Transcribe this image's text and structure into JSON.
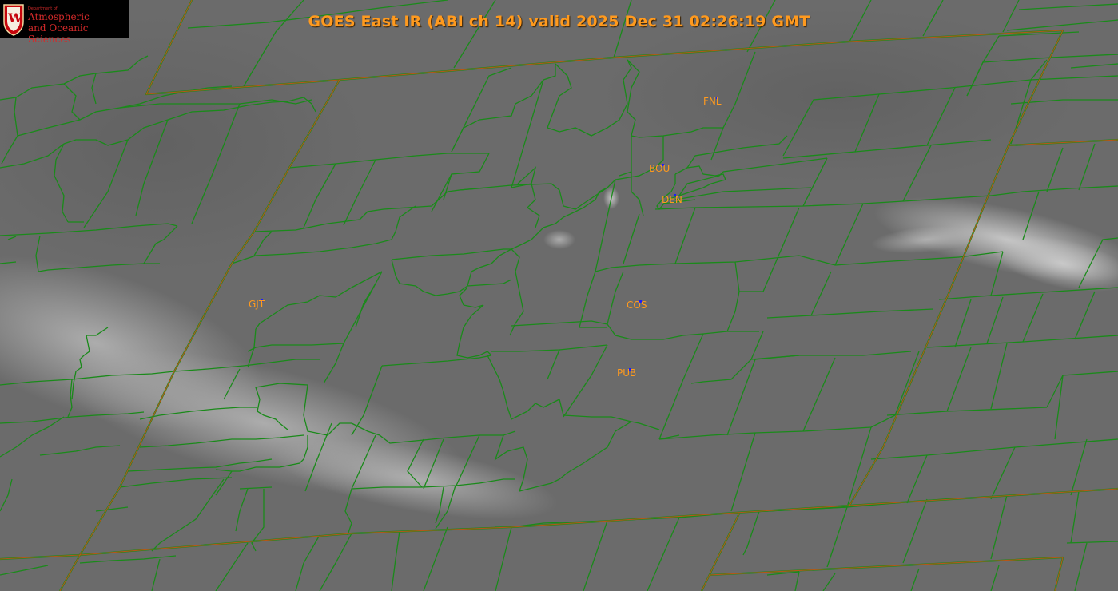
{
  "header": {
    "title": "GOES East IR (ABI ch 14) valid 2025 Dec 31 02:26:19 GMT"
  },
  "logo": {
    "department": "Department of",
    "line1": "Atmospheric",
    "line2": "and Oceanic Sciences",
    "crest_letter": "W",
    "crest_color": "#c5050c"
  },
  "colors": {
    "county_lines": "#1a8a1a",
    "state_lines": "#c8501a",
    "label": "#ff9a1e",
    "station_dot": "#1a1aff",
    "ir_background": "#6e6e6e"
  },
  "stations": [
    {
      "id": "FNL"
    },
    {
      "id": "BOU"
    },
    {
      "id": "DEN"
    },
    {
      "id": "GJT"
    },
    {
      "id": "COS"
    },
    {
      "id": "PUB"
    }
  ]
}
